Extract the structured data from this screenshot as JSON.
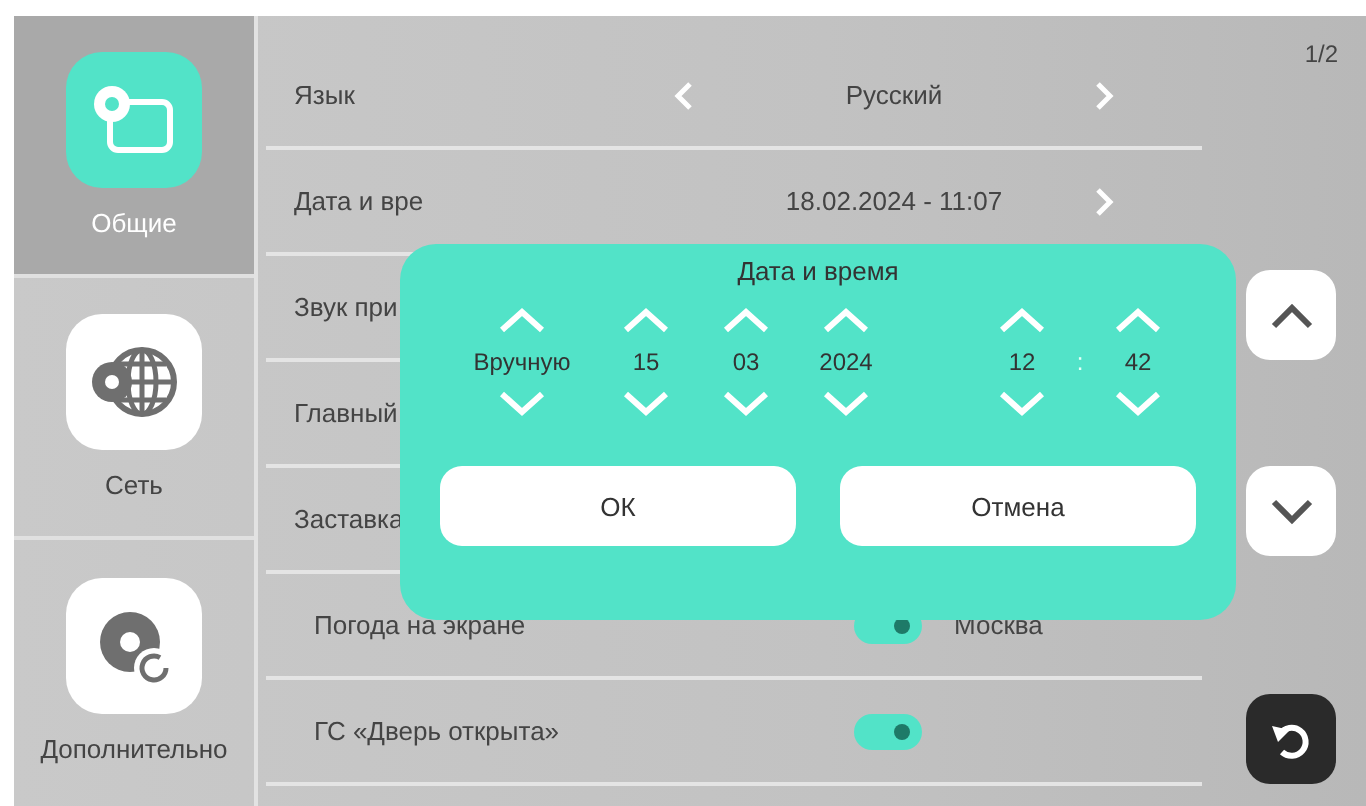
{
  "sidebar": {
    "items": [
      {
        "kind": "general",
        "label": "Общие",
        "selected": true
      },
      {
        "kind": "network",
        "label": "Сеть",
        "selected": false
      },
      {
        "kind": "advanced",
        "label": "Дополнительно",
        "selected": false
      }
    ]
  },
  "page_indicator": "1/2",
  "settings": [
    {
      "kind": "select",
      "label": "Язык",
      "value": "Русский"
    },
    {
      "kind": "link",
      "label": "Дата и вре",
      "value": "18.02.2024 - 11:07"
    },
    {
      "kind": "plain",
      "label": "Звук при"
    },
    {
      "kind": "plain",
      "label": "Главный"
    },
    {
      "kind": "plain",
      "label": "Заставка"
    },
    {
      "kind": "toggle",
      "label": "Погода на экране",
      "on": true,
      "value": "Москва"
    },
    {
      "kind": "toggle",
      "label": "ГС «Дверь открыта»",
      "on": true
    }
  ],
  "dialog": {
    "title": "Дата и время",
    "fields": [
      {
        "kind": "spinner",
        "value": "Вручную"
      },
      {
        "kind": "spinner",
        "value": "15"
      },
      {
        "kind": "spinner",
        "value": "03"
      },
      {
        "kind": "spinner",
        "value": "2024"
      },
      {
        "kind": "gap"
      },
      {
        "kind": "spinner",
        "value": "12"
      },
      {
        "kind": "separator",
        "value": ":"
      },
      {
        "kind": "spinner",
        "value": "42"
      }
    ],
    "buttons": [
      "ОК",
      "Отмена"
    ]
  }
}
